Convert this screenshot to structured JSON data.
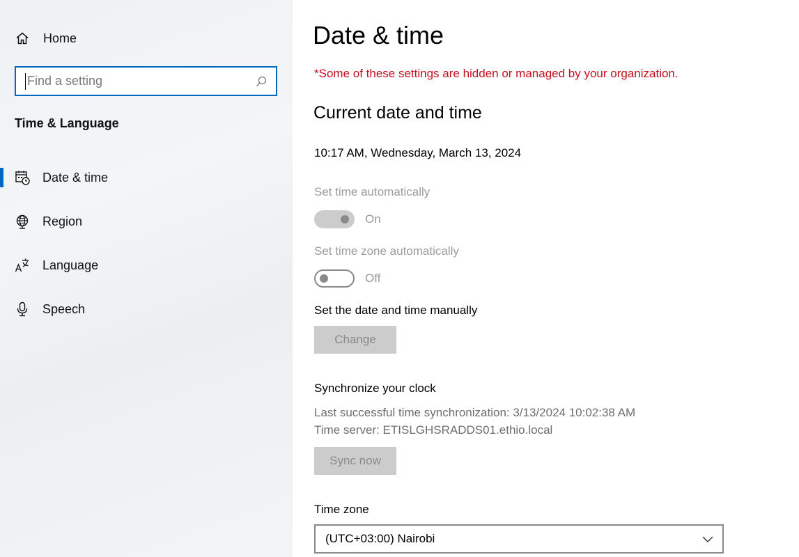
{
  "sidebar": {
    "home_label": "Home",
    "search_placeholder": "Find a setting",
    "section_title": "Time & Language",
    "items": [
      {
        "label": "Date & time",
        "icon": "calendar-clock-icon",
        "active": true
      },
      {
        "label": "Region",
        "icon": "globe-icon",
        "active": false
      },
      {
        "label": "Language",
        "icon": "language-icon",
        "active": false
      },
      {
        "label": "Speech",
        "icon": "microphone-icon",
        "active": false
      }
    ]
  },
  "main": {
    "title": "Date & time",
    "warning": "*Some of these settings are hidden or managed by your organization.",
    "current_heading": "Current date and time",
    "current_time": "10:17 AM, Wednesday, March 13, 2024",
    "set_time_auto": {
      "label": "Set time automatically",
      "state": "On"
    },
    "set_zone_auto": {
      "label": "Set time zone automatically",
      "state": "Off"
    },
    "manual_label": "Set the date and time manually",
    "change_button": "Change",
    "sync_heading": "Synchronize your clock",
    "sync_last": "Last successful time synchronization: 3/13/2024 10:02:38 AM",
    "sync_server": "Time server: ETISLGHSRADDS01.ethio.local",
    "sync_button": "Sync now",
    "timezone_label": "Time zone",
    "timezone_value": "(UTC+03:00) Nairobi"
  },
  "colors": {
    "accent": "#0067c0",
    "warning": "#c50f1f",
    "disabled_text": "#9a9a9a"
  }
}
